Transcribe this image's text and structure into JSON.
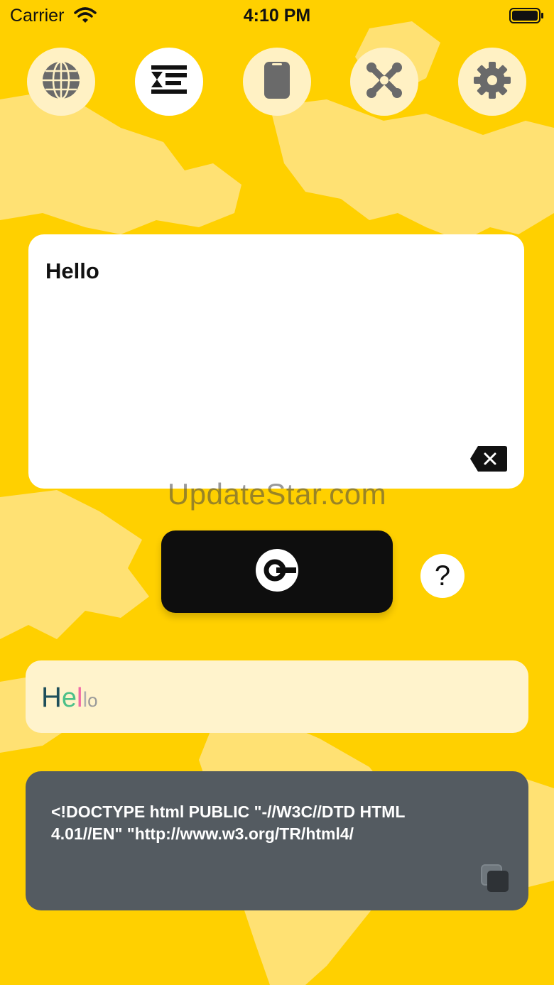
{
  "status_bar": {
    "carrier": "Carrier",
    "time": "4:10 PM"
  },
  "tabs": [
    {
      "icon": "globe-icon",
      "active": false
    },
    {
      "icon": "text-format-icon",
      "active": true
    },
    {
      "icon": "phone-icon",
      "active": false
    },
    {
      "icon": "joomla-icon",
      "active": false
    },
    {
      "icon": "gear-icon",
      "active": false
    }
  ],
  "input": {
    "text": "Hello",
    "clear_icon": "backspace-clear-icon"
  },
  "watermark": "UpdateStar.com",
  "convert_button": {
    "icon": "convert-icon"
  },
  "help_button": {
    "label": "?"
  },
  "preview": {
    "letters": [
      {
        "char": "H",
        "color": "#1F4E5A"
      },
      {
        "char": "e",
        "color": "#4CC089"
      },
      {
        "char": "l",
        "color": "#F06AA6"
      },
      {
        "char": "l",
        "color": "#B0B0B0"
      },
      {
        "char": "o",
        "color": "#9A9A9A"
      }
    ]
  },
  "code_output": {
    "text": "<!DOCTYPE html PUBLIC \"-//W3C//DTD HTML 4.01//EN\" \"http://www.w3.org/TR/html4/",
    "copy_icon": "copy-icon"
  },
  "colors": {
    "background": "#FFD000",
    "map": "#FFE173",
    "code_card": "#545B61",
    "preview_card": "#FFF3CC"
  }
}
